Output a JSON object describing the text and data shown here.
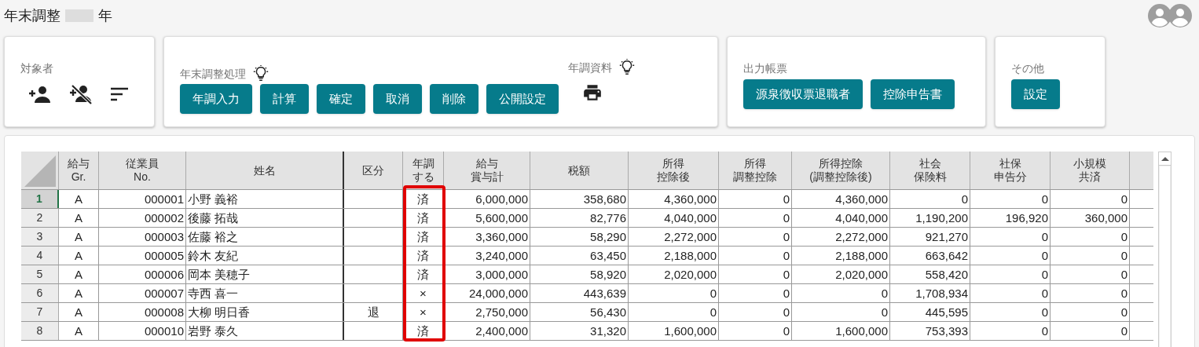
{
  "page": {
    "title": "年末調整",
    "year_suffix": "年"
  },
  "toolbar": [
    {
      "kind": "icons",
      "label": "対象者"
    },
    {
      "kind": "processing",
      "sections": [
        {
          "label": "年末調整処理",
          "buttons": [
            "年調入力",
            "計算",
            "確定",
            "取消",
            "削除",
            "公開設定"
          ]
        },
        {
          "label": "年調資料"
        }
      ]
    },
    {
      "kind": "buttons",
      "label": "出力帳票",
      "buttons": [
        "源泉徴収票退職者",
        "控除申告書"
      ]
    },
    {
      "kind": "buttons",
      "label": "その他",
      "buttons": [
        "設定"
      ]
    }
  ],
  "table": {
    "columns": [
      {
        "lines": [
          "給与",
          "Gr."
        ]
      },
      {
        "lines": [
          "従業員",
          "No."
        ]
      },
      {
        "lines": [
          "姓名"
        ]
      },
      {
        "lines": [
          "区分"
        ]
      },
      {
        "lines": [
          "年調",
          "する"
        ]
      },
      {
        "lines": [
          "給与",
          "賞与計"
        ]
      },
      {
        "lines": [
          "税額"
        ]
      },
      {
        "lines": [
          "所得",
          "控除後"
        ]
      },
      {
        "lines": [
          "所得",
          "調整控除"
        ]
      },
      {
        "lines": [
          "所得控除",
          "(調整控除後)"
        ]
      },
      {
        "lines": [
          "社会",
          "保険料"
        ]
      },
      {
        "lines": [
          "社保",
          "申告分"
        ]
      },
      {
        "lines": [
          "小規模",
          "共済"
        ]
      }
    ],
    "rows": [
      {
        "number": "1",
        "selected": true,
        "cells": [
          "A",
          "000001",
          "小野 義裕",
          null,
          "済",
          "6,000,000",
          "358,680",
          "4,360,000",
          "0",
          "4,360,000",
          "0",
          "0",
          "0"
        ]
      },
      {
        "number": "2",
        "selected": false,
        "cells": [
          "A",
          "000002",
          "後藤 拓哉",
          null,
          "済",
          "5,600,000",
          "82,776",
          "4,040,000",
          "0",
          "4,040,000",
          "1,190,200",
          "196,920",
          "360,000"
        ]
      },
      {
        "number": "3",
        "selected": false,
        "cells": [
          "A",
          "000003",
          "佐藤 裕之",
          null,
          "済",
          "3,360,000",
          "58,290",
          "2,272,000",
          "0",
          "2,272,000",
          "921,270",
          "0",
          "0"
        ]
      },
      {
        "number": "4",
        "selected": false,
        "cells": [
          "A",
          "000005",
          "鈴木 友紀",
          null,
          "済",
          "3,240,000",
          "63,450",
          "2,188,000",
          "0",
          "2,188,000",
          "663,642",
          "0",
          "0"
        ]
      },
      {
        "number": "5",
        "selected": false,
        "cells": [
          "A",
          "000006",
          "岡本 美穂子",
          null,
          "済",
          "3,000,000",
          "58,920",
          "2,020,000",
          "0",
          "2,020,000",
          "558,420",
          "0",
          "0"
        ]
      },
      {
        "number": "6",
        "selected": false,
        "cells": [
          "A",
          "000007",
          "寺西 喜一",
          null,
          "×",
          "24,000,000",
          "443,639",
          "0",
          "0",
          "0",
          "1,708,934",
          "0",
          "0"
        ]
      },
      {
        "number": "7",
        "selected": false,
        "cells": [
          "A",
          "000008",
          "大柳 明日香",
          "退",
          "×",
          "2,750,000",
          "56,430",
          "0",
          "0",
          "0",
          "445,595",
          "0",
          "0"
        ]
      },
      {
        "number": "8",
        "selected": false,
        "cells": [
          "A",
          "000010",
          "岩野 泰久",
          null,
          "済",
          "2,400,000",
          "31,320",
          "1,600,000",
          "0",
          "1,600,000",
          "753,393",
          "0",
          "0"
        ]
      }
    ]
  }
}
